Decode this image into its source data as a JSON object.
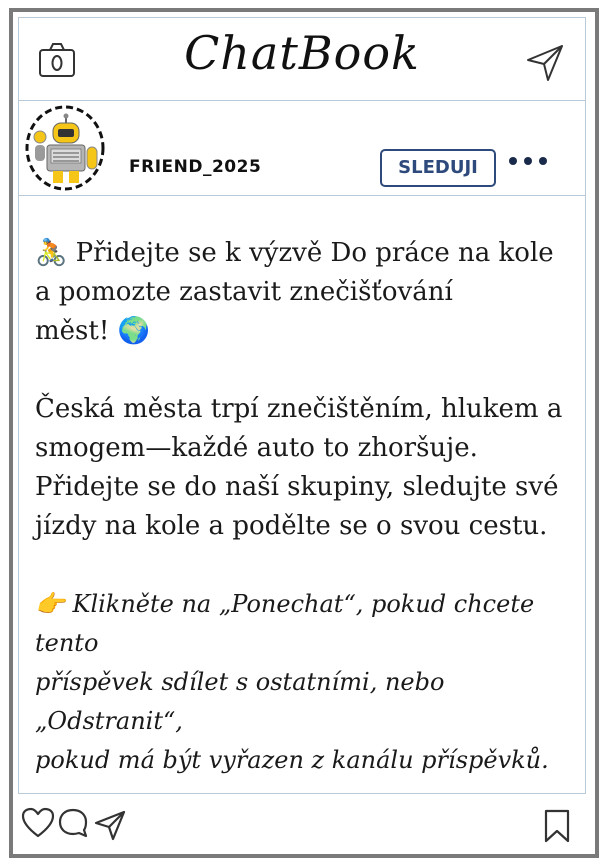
{
  "app": {
    "title": "ChatBook"
  },
  "header": {
    "left_icon": "camera-icon",
    "right_icon": "send-icon"
  },
  "profile": {
    "username": "FRIEND_2025",
    "avatar": "robot-avatar",
    "follow_label": "SLEDUJI",
    "more_icon": "more-dots-icon"
  },
  "post": {
    "paragraphs": [
      "🚴 Přidejte se k výzvě Do práce na kole\na pomozte zastavit znečišťování\nměst! 🌍",
      "Česká města trpí znečištěním, hlukem a\nsmogem—každé auto to zhoršuje.\nPřidejte se do naší skupiny, sledujte své\njízdy na kole a podělte se o svou cestu."
    ],
    "note": "👉 Klikněte na „Ponechat“, pokud chcete tento\npříspěvek sdílet s ostatními, nebo „Odstranit“,\npokud má být vyřazen z kanálu příspěvků."
  },
  "footer": {
    "icons": [
      "heart-icon",
      "comment-icon",
      "share-icon",
      "bookmark-icon"
    ]
  },
  "colors": {
    "frame": "#7a7a7a",
    "divider": "#b8cad8",
    "follow_accent": "#2e4a7d"
  }
}
